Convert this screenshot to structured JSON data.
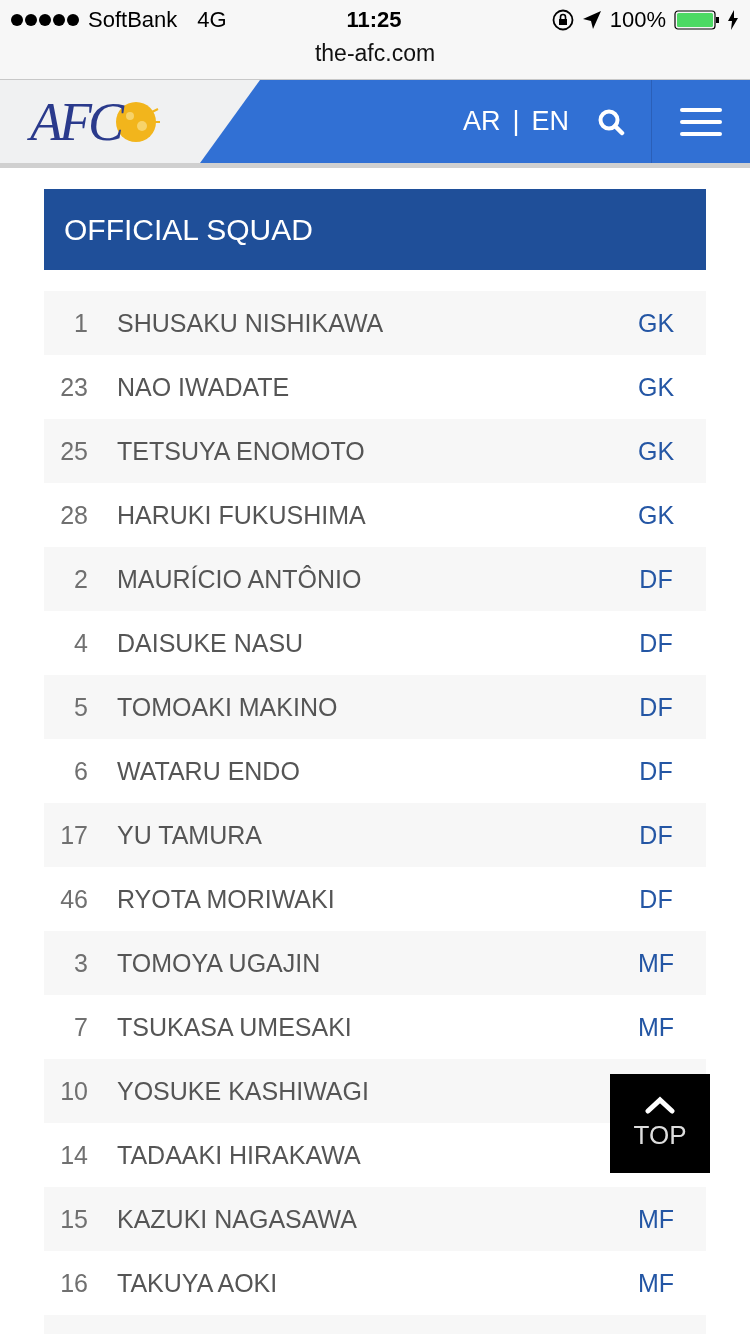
{
  "status_bar": {
    "carrier": "SoftBank",
    "network": "4G",
    "time": "11:25",
    "battery": "100%"
  },
  "url_bar": {
    "url": "the-afc.com"
  },
  "header": {
    "logo_text": "AFC",
    "languages": [
      "AR",
      "EN"
    ],
    "separator": "|"
  },
  "squad": {
    "title": "OFFICIAL SQUAD",
    "players": [
      {
        "number": "1",
        "name": "SHUSAKU NISHIKAWA",
        "position": "GK"
      },
      {
        "number": "23",
        "name": "NAO IWADATE",
        "position": "GK"
      },
      {
        "number": "25",
        "name": "TETSUYA ENOMOTO",
        "position": "GK"
      },
      {
        "number": "28",
        "name": "HARUKI FUKUSHIMA",
        "position": "GK"
      },
      {
        "number": "2",
        "name": "MAURÍCIO ANTÔNIO",
        "position": "DF"
      },
      {
        "number": "4",
        "name": "DAISUKE NASU",
        "position": "DF"
      },
      {
        "number": "5",
        "name": "TOMOAKI MAKINO",
        "position": "DF"
      },
      {
        "number": "6",
        "name": "WATARU ENDO",
        "position": "DF"
      },
      {
        "number": "17",
        "name": "YU TAMURA",
        "position": "DF"
      },
      {
        "number": "46",
        "name": "RYOTA MORIWAKI",
        "position": "DF"
      },
      {
        "number": "3",
        "name": "TOMOYA UGAJIN",
        "position": "MF"
      },
      {
        "number": "7",
        "name": "TSUKASA UMESAKI",
        "position": "MF"
      },
      {
        "number": "10",
        "name": "YOSUKE KASHIWAGI"
      },
      {
        "number": "14",
        "name": "TADAAKI HIRAKAWA"
      },
      {
        "number": "15",
        "name": "KAZUKI NAGASAWA",
        "position": "MF"
      },
      {
        "number": "16",
        "name": "TAKUYA AOKI",
        "position": "MF"
      }
    ]
  },
  "top_button": {
    "label": "TOP"
  }
}
